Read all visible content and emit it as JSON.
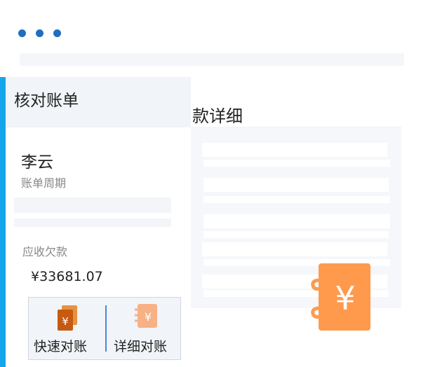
{
  "window": {
    "controls_icon": "three-dots-icon"
  },
  "left_panel": {
    "title": "核对账单",
    "customer_name": "李云",
    "period_label": "账单周期",
    "receivable_label": "应收欠款",
    "receivable_amount": "¥33681.07"
  },
  "actions": {
    "quick_label": "快速对账",
    "detail_label": "详细对账",
    "quick_icon": "yen-documents-icon",
    "detail_icon": "yen-notebook-icon"
  },
  "right_panel": {
    "title": "款详细",
    "feature_icon": "yen-notebook-icon"
  },
  "colors": {
    "accent": "#14a6ea",
    "dots": "#1f6fc0",
    "divider": "#4a88d8",
    "icon_dark_orange": "#d2691e",
    "icon_orange": "#ff9a4d",
    "icon_light_orange": "#f7b184"
  }
}
